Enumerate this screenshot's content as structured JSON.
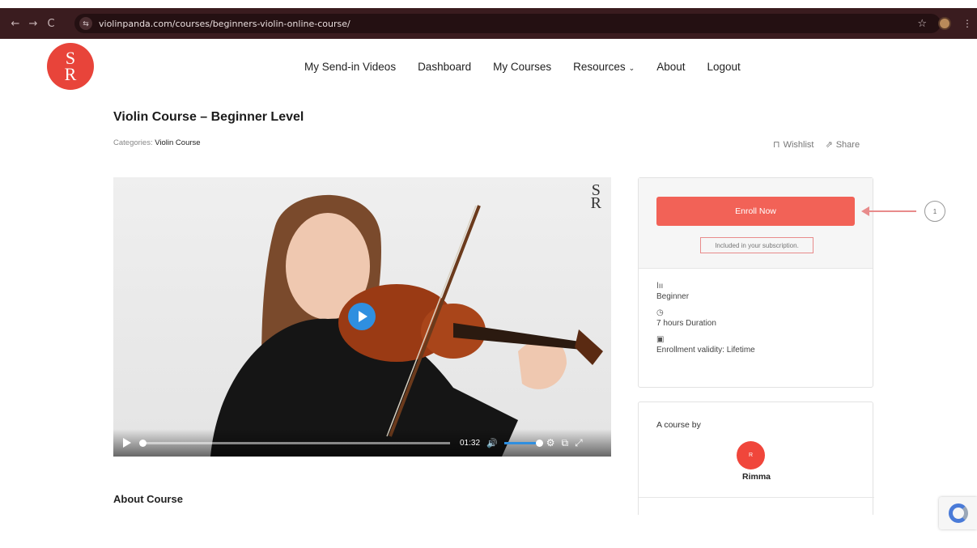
{
  "browser": {
    "back": "←",
    "forward": "→",
    "reload": "C",
    "site_icon": "⇆",
    "url": "violinpanda.com/courses/beginners-violin-online-course/",
    "star": "☆",
    "more": "⋮"
  },
  "site": {
    "logo_mark_top": "S",
    "logo_mark_bottom": "R",
    "nav": {
      "send_in_videos": "My Send-in Videos",
      "dashboard": "Dashboard",
      "my_courses": "My Courses",
      "resources": "Resources",
      "resources_chevron": "⌄",
      "about": "About",
      "logout": "Logout"
    }
  },
  "course": {
    "title": "Violin Course – Beginner Level",
    "categories_label": "Categories:",
    "category": "Violin Course",
    "wishlist_icon": "⊓",
    "wishlist": "Wishlist",
    "share_icon": "⇗",
    "share": "Share",
    "about_heading": "About Course"
  },
  "video": {
    "watermark_top": "S",
    "watermark_bottom": "R",
    "current_time": "01:32",
    "progress": 0.0,
    "volume": 1.0,
    "volume_icon": "🔊",
    "settings_icon": "⚙",
    "pip_icon": "⧉",
    "fullscreen_icon": "⤢"
  },
  "enroll": {
    "button": "Enroll Now",
    "note": "Included in your subscription.",
    "level_icon": "lıı",
    "level": "Beginner",
    "duration_icon": "◷",
    "duration": "7 hours  Duration",
    "validity_icon": "▣",
    "validity": "Enrollment validity: Lifetime",
    "accent_color": "#f26257"
  },
  "author": {
    "label": "A course by",
    "avatar_initial": "R",
    "name": "Rimma"
  },
  "annotation": {
    "step": "1",
    "color": "#e88b8b"
  }
}
